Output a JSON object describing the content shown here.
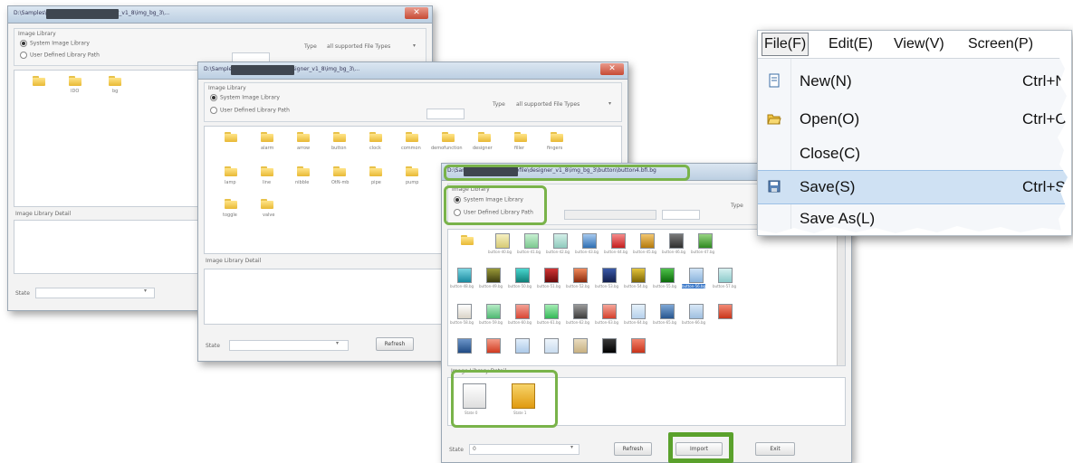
{
  "window1": {
    "title": "D:\\Samples\\[redacted]\\Profile\\designer_v1_8\\img_bg_3\\...",
    "group_title": "Image Library",
    "radio_system": "System Image Library",
    "radio_user": "User Defined Library Path",
    "type_label": "Type",
    "type_value": "all supported File Types",
    "folders": [
      "",
      "IDO",
      "bg"
    ],
    "detail_title": "Image Library Detail",
    "state_label": "State"
  },
  "window2": {
    "title": "D:\\Samples\\[redacted]\\Profile\\designer_v1_8\\img_bg_3\\...",
    "group_title": "Image Library",
    "radio_system": "System Image Library",
    "radio_user": "User Defined Library Path",
    "type_label": "Type",
    "type_value": "all supported File Types",
    "folders": [
      "",
      "alarm",
      "arrow",
      "button",
      "clock",
      "common",
      "demofunction",
      "designer",
      "filler",
      "fingers",
      "lamp",
      "line",
      "nibble",
      "OtN-mb",
      "pipe",
      "pump",
      "toggle",
      "valve"
    ],
    "detail_title": "Image Library Detail",
    "state_label": "State",
    "refresh_button": "Refresh"
  },
  "window3": {
    "title": "D:\\Samples\\[redacted]\\Profile\\designer_v1_8\\img_bg_3\\button\\button4.bfi.bg",
    "group_title": "Image Library",
    "radio_system": "System Image Library",
    "radio_user": "User Defined Library Path",
    "type_label": "Type",
    "thumb_labels_row1": [
      "",
      "button-40.bg",
      "button-41.bg",
      "button-42.bg",
      "button-43.bg",
      "button-44.bg",
      "button-45.bg",
      "button-46.bg",
      "button-47.bg"
    ],
    "thumb_labels_row2": [
      "button-48.bg",
      "button-49.bg",
      "button-50.bg",
      "button-51.bg",
      "button-52.bg",
      "button-53.bg",
      "button-54.bg",
      "button-55.bg",
      "button-56.bg",
      "button-57.bg"
    ],
    "thumb_labels_row3": [
      "button-58.bg",
      "button-59.bg",
      "button-60.bg",
      "button-61.bg",
      "button-62.bg",
      "button-63.bg",
      "button-64.bg",
      "button-65.bg",
      "button-66.bg"
    ],
    "detail_title": "Image Library Detail",
    "state_label": "State",
    "state_value": "0",
    "detail_items": [
      "State 0",
      "State 1"
    ],
    "refresh_button": "Refresh",
    "import_button": "Import",
    "exit_button": "Exit"
  },
  "menu": {
    "bar": [
      "File(F)",
      "Edit(E)",
      "View(V)",
      "Screen(P)"
    ],
    "items": [
      {
        "label": "New(N)",
        "shortcut": "Ctrl+N",
        "icon": "new-file-icon"
      },
      {
        "label": "Open(O)",
        "shortcut": "Ctrl+O",
        "icon": "open-folder-icon"
      },
      {
        "label": "Close(C)",
        "shortcut": "",
        "icon": ""
      },
      {
        "label": "Save(S)",
        "shortcut": "Ctrl+S",
        "icon": "save-disk-icon"
      },
      {
        "label": "Save As(L)",
        "shortcut": "",
        "icon": ""
      }
    ]
  },
  "colors": {
    "highlight_green": "#79b34a",
    "import_highlight": "#5aa12c",
    "menu_selection": "#cfe1f3",
    "folder_yellow": "#f2cc4a"
  }
}
